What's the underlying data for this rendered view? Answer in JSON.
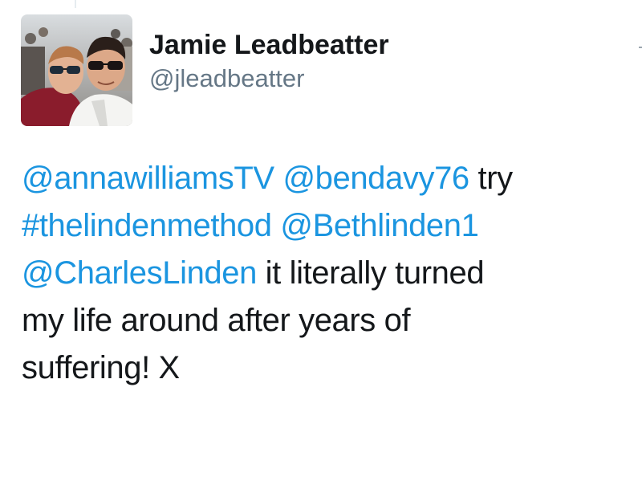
{
  "tweet": {
    "author": {
      "display_name": "Jamie Leadbeatter",
      "handle": "@jleadbeatter"
    },
    "text_lines": [
      [
        {
          "text": "@annawilliamsTV",
          "kind": "mention"
        },
        {
          "text": " ",
          "kind": "text"
        },
        {
          "text": "@bendavy76",
          "kind": "mention"
        },
        {
          "text": " try",
          "kind": "text"
        }
      ],
      [
        {
          "text": "#thelindenmethod",
          "kind": "hashtag"
        },
        {
          "text": " ",
          "kind": "text"
        },
        {
          "text": "@Bethlinden1",
          "kind": "mention"
        }
      ],
      [
        {
          "text": "@CharlesLinden",
          "kind": "mention"
        },
        {
          "text": " it literally turned",
          "kind": "text"
        }
      ],
      [
        {
          "text": "my life around after years of",
          "kind": "text"
        }
      ],
      [
        {
          "text": "suffering! X",
          "kind": "text"
        }
      ]
    ]
  },
  "colors": {
    "link": "#1b95e0",
    "text": "#14171a",
    "handle": "#657786"
  }
}
